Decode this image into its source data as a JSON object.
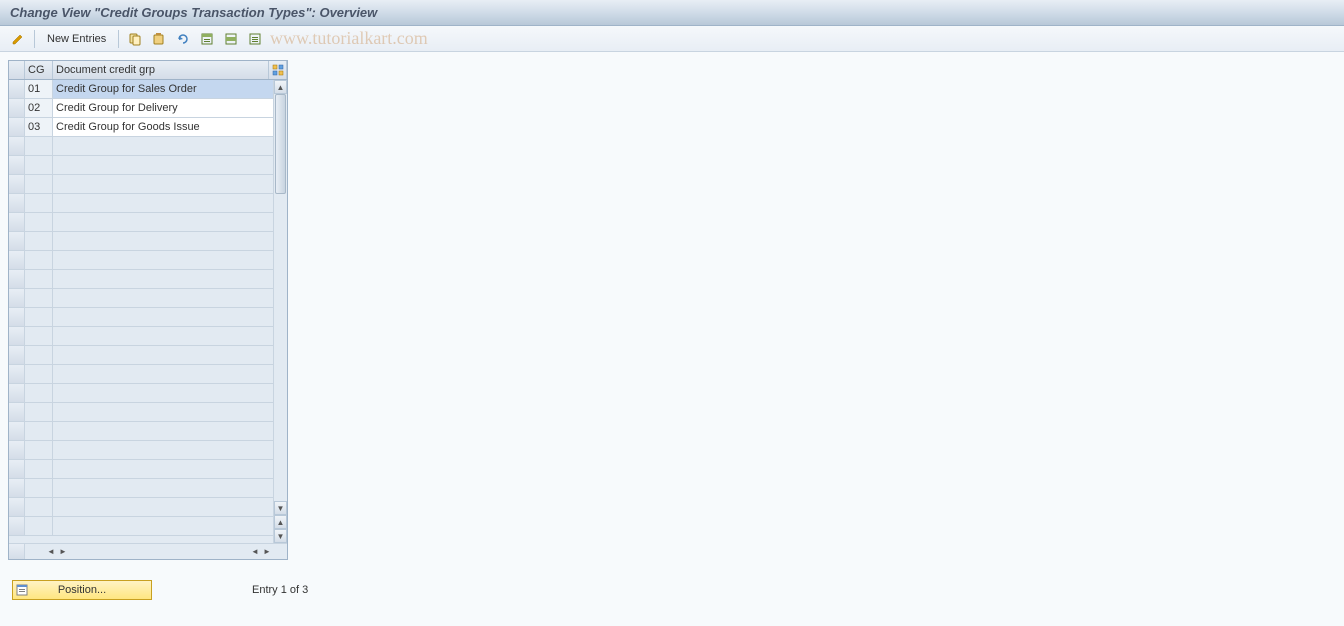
{
  "title": "Change View \"Credit Groups Transaction Types\": Overview",
  "toolbar": {
    "new_entries_label": "New Entries"
  },
  "watermark": "www.tutorialkart.com",
  "table": {
    "headers": {
      "cg": "CG",
      "desc": "Document credit grp"
    },
    "rows": [
      {
        "cg": "01",
        "desc": "Credit Group for Sales Order",
        "selected": true
      },
      {
        "cg": "02",
        "desc": "Credit Group for Delivery",
        "selected": false
      },
      {
        "cg": "03",
        "desc": "Credit Group for Goods Issue",
        "selected": false
      }
    ],
    "empty_row_count": 21
  },
  "footer": {
    "position_label": "Position...",
    "entry_text": "Entry 1 of 3"
  }
}
